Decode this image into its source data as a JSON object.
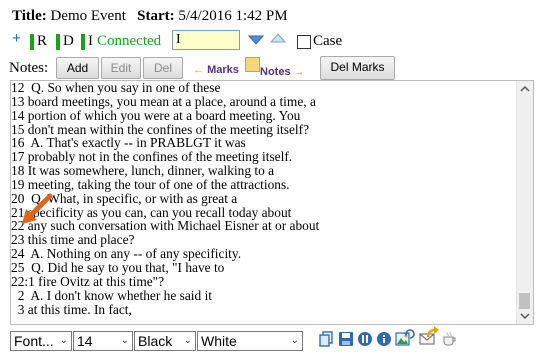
{
  "header": {
    "title_label": "Title:",
    "title_value": "Demo Event",
    "start_label": "Start:",
    "start_value": "5/4/2016 1:42 PM"
  },
  "toolbar": {
    "r": "R",
    "d": "D",
    "i": "I",
    "status": "Connected",
    "search_value": "I",
    "case_label": "Case",
    "status_color": "#1aa21a"
  },
  "notes_bar": {
    "notes_label": "Notes:",
    "add": "Add",
    "edit": "Edit",
    "del": "Del",
    "marks": "Marks",
    "notes": "Notes",
    "del_marks": "Del Marks"
  },
  "transcript": {
    "lines": [
      "12  Q. So when you say in one of these",
      "13 board meetings, you mean at a place, around a time, a",
      "14 portion of which you were at a board meeting. You",
      "15 don't mean within the confines of the meeting itself?",
      "16  A. That's exactly -- in PRABLGT it was",
      "17 probably not in the confines of the meeting itself.",
      "18 It was somewhere, lunch, dinner, walking to a",
      "19 meeting, taking the tour of one of the attractions.",
      "20  Q. What, in specific, or with as great a",
      "21 specificity as you can, can you recall today about",
      "22 any such conversation with Michael Eisner at or about",
      "23 this time and place?",
      "24  A. Nothing on any -- of any specificity.",
      "25  Q. Did he say to you that, \"I have to",
      "22:1 fire Ovitz at this time\"?",
      "  2  A. I don't know whether he said it",
      "  3 at this time. In fact,"
    ]
  },
  "format_bar": {
    "font": "Font...",
    "size": "14",
    "color": "Black",
    "background": "White"
  }
}
